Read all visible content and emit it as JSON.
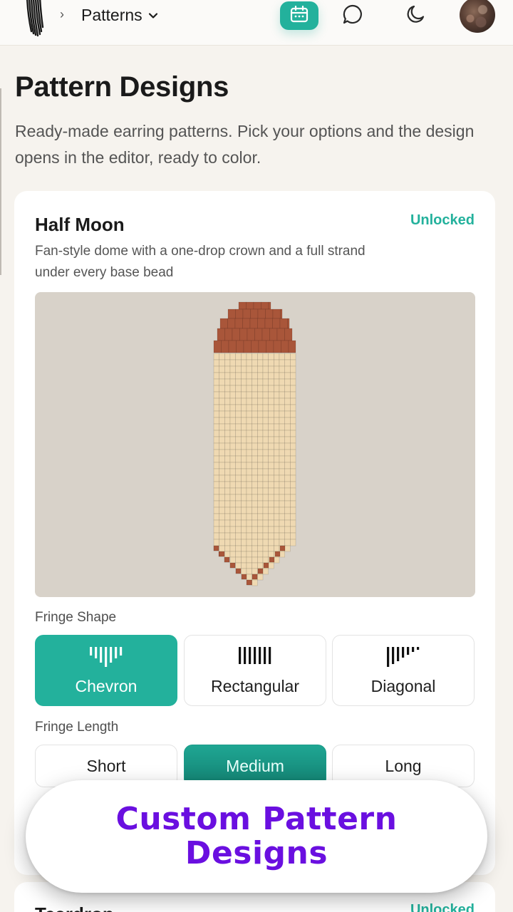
{
  "breadcrumb": {
    "separator": "›",
    "current": "Patterns"
  },
  "icons": {
    "logo": "fringe-earring-logo-icon",
    "breadcrumb_chevron": "chevron-down-icon",
    "calendar": "calendar-icon",
    "chat": "chat-bubble-icon",
    "theme": "moon-icon",
    "avatar": "user-avatar"
  },
  "colors": {
    "accent": "#23b19c",
    "banner_text": "#6a0fe0",
    "bead_crown": "#a9563a",
    "bead_fringe": "#efd9b2"
  },
  "page": {
    "title": "Pattern Designs",
    "subtitle": "Ready-made earring patterns. Pick your options and the design opens in the editor, ready to color."
  },
  "card": {
    "title": "Half Moon",
    "status": "Unlocked",
    "description": "Fan-style dome with a one-drop crown and a full strand under every base bead",
    "fringe_shape": {
      "label": "Fringe Shape",
      "options": [
        {
          "label": "Chevron",
          "icon": "chevron-fringe-icon",
          "selected": true
        },
        {
          "label": "Rectangular",
          "icon": "rectangular-fringe-icon",
          "selected": false
        },
        {
          "label": "Diagonal",
          "icon": "diagonal-fringe-icon",
          "selected": false
        }
      ]
    },
    "fringe_length": {
      "label": "Fringe Length",
      "options": [
        {
          "label": "Short",
          "selected": false
        },
        {
          "label": "Medium",
          "selected": true
        },
        {
          "label": "Long",
          "selected": false
        }
      ]
    }
  },
  "next_card": {
    "title": "Teardrop",
    "status": "Unlocked"
  },
  "banner": {
    "text": "Custom Pattern Designs"
  }
}
